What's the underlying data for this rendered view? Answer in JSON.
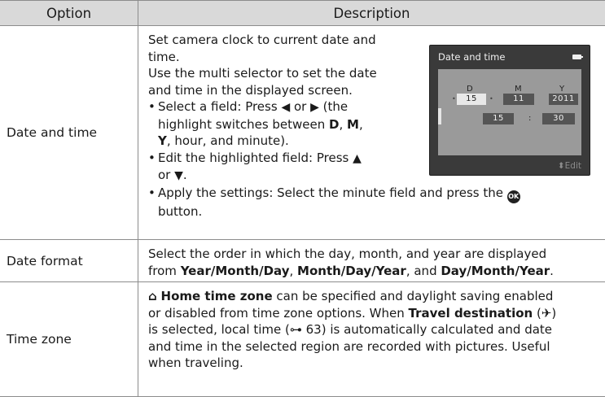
{
  "header": {
    "option": "Option",
    "description": "Description"
  },
  "rows": {
    "date_time": {
      "option": "Date and time",
      "line1": "Set camera clock to current date and",
      "line2": "time.",
      "line3": "Use the multi selector to set the date",
      "line4": "and time in the displayed screen.",
      "b1_a": "Select a field: Press ",
      "b1_left": "◀",
      "b1_or": " or ",
      "b1_right": "▶",
      "b1_b": " (the",
      "b1_c": "highlight switches between ",
      "b1_D": "D",
      "b1_comma1": ", ",
      "b1_M": "M",
      "b1_comma2": ",",
      "b1_Y": "Y",
      "b1_d": ", hour, and minute).",
      "b2_a": "Edit the highlighted field: Press ",
      "b2_up": "▲",
      "b2_b": "or ",
      "b2_down": "▼",
      "b2_c": ".",
      "b3_a": "Apply the settings: Select the minute field and press the ",
      "b3_ok": "OK",
      "b3_b": "button."
    },
    "date_format": {
      "option": "Date format",
      "t1": "Select the order in which the day, month, and year are displayed",
      "t2": "from ",
      "f1": "Year/Month/Day",
      "c1": ", ",
      "f2": "Month/Day/Year",
      "c2": ", and ",
      "f3": "Day/Month/Year",
      "end": "."
    },
    "time_zone": {
      "option": "Time zone",
      "home_icon": "⌂",
      "home_label": "Home time zone",
      "t1": " can be specified and daylight saving enabled",
      "t2": "or disabled from time zone options. When ",
      "travel_label": "Travel destination",
      "travel_icon": "(✈)",
      "t3": "is selected, local time (",
      "ref_icon": "⊶",
      "ref_page": " 63",
      "t4": ") is automatically calculated and date",
      "t5": "and time in the selected region are recorded with pictures. Useful",
      "t6": "when traveling."
    }
  },
  "camera_screen": {
    "title": "Date and time",
    "label_d": "D",
    "label_m": "M",
    "label_y": "Y",
    "day": "15",
    "month": "11",
    "year": "2011",
    "hour": "15",
    "colon": ":",
    "minute": "30",
    "edit_label": "⬍Edit"
  }
}
